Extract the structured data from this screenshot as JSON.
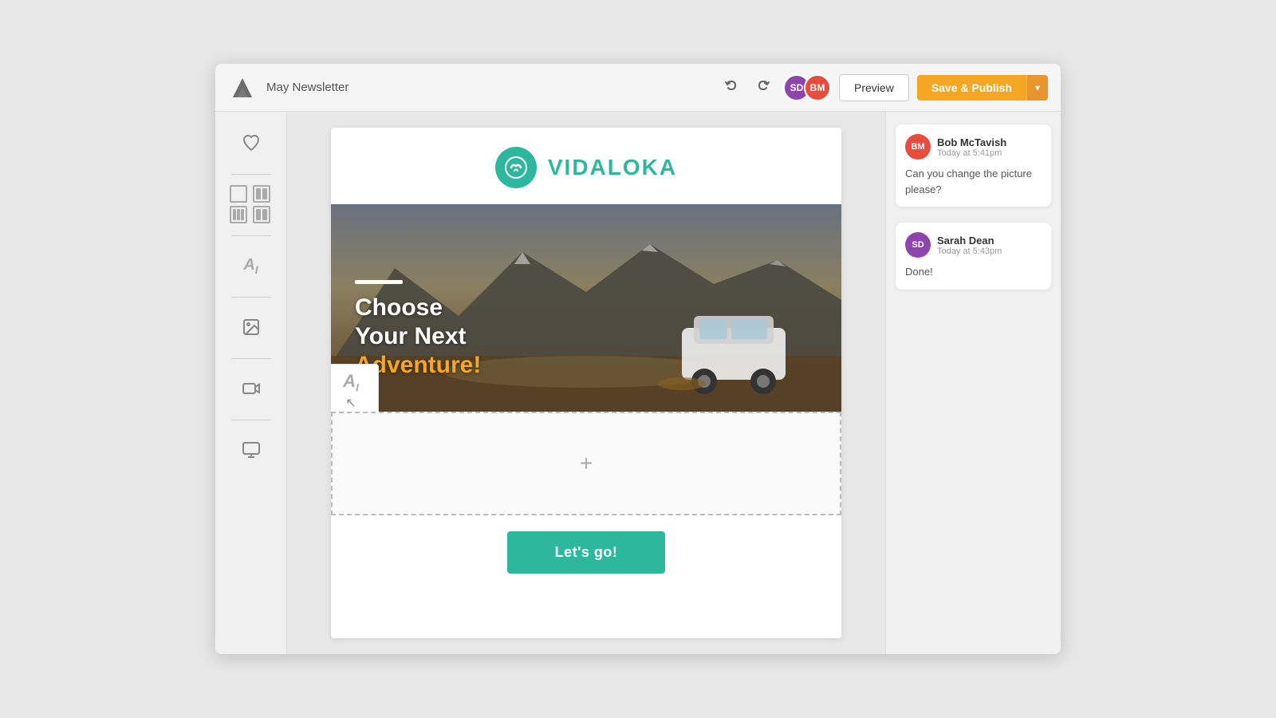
{
  "header": {
    "title": "May Newsletter",
    "undo_label": "↩",
    "redo_label": "↪",
    "preview_label": "Preview",
    "save_publish_label": "Save & Publish",
    "avatar_sd_initials": "SD",
    "avatar_bm_initials": "BM"
  },
  "sidebar": {
    "items": [
      {
        "name": "favorites",
        "icon": "heart"
      },
      {
        "name": "layout-single",
        "icon": "square"
      },
      {
        "name": "layout-split",
        "icon": "split"
      },
      {
        "name": "layout-triple",
        "icon": "triple"
      },
      {
        "name": "layout-quad",
        "icon": "quad"
      },
      {
        "name": "text-ai",
        "icon": "Ai"
      },
      {
        "name": "image",
        "icon": "image"
      },
      {
        "name": "video",
        "icon": "video"
      },
      {
        "name": "social",
        "icon": "social"
      }
    ]
  },
  "email": {
    "brand_name": "VIDALOKA",
    "hero": {
      "accent_bar": true,
      "headline_line1": "Choose",
      "headline_line2": "Your Next",
      "headline_line3": "Adventure!"
    },
    "drop_zone_plus": "+",
    "cta_button": "Let's go!"
  },
  "floating_element": {
    "label": "Ai",
    "cursor": "↖"
  },
  "comments": [
    {
      "author": "Bob McTavish",
      "initials": "BM",
      "time": "Today at 5:41pm",
      "text": "Can you change the picture please?"
    },
    {
      "author": "Sarah Dean",
      "initials": "SD",
      "time": "Today at 5:43pm",
      "text": "Done!"
    }
  ]
}
